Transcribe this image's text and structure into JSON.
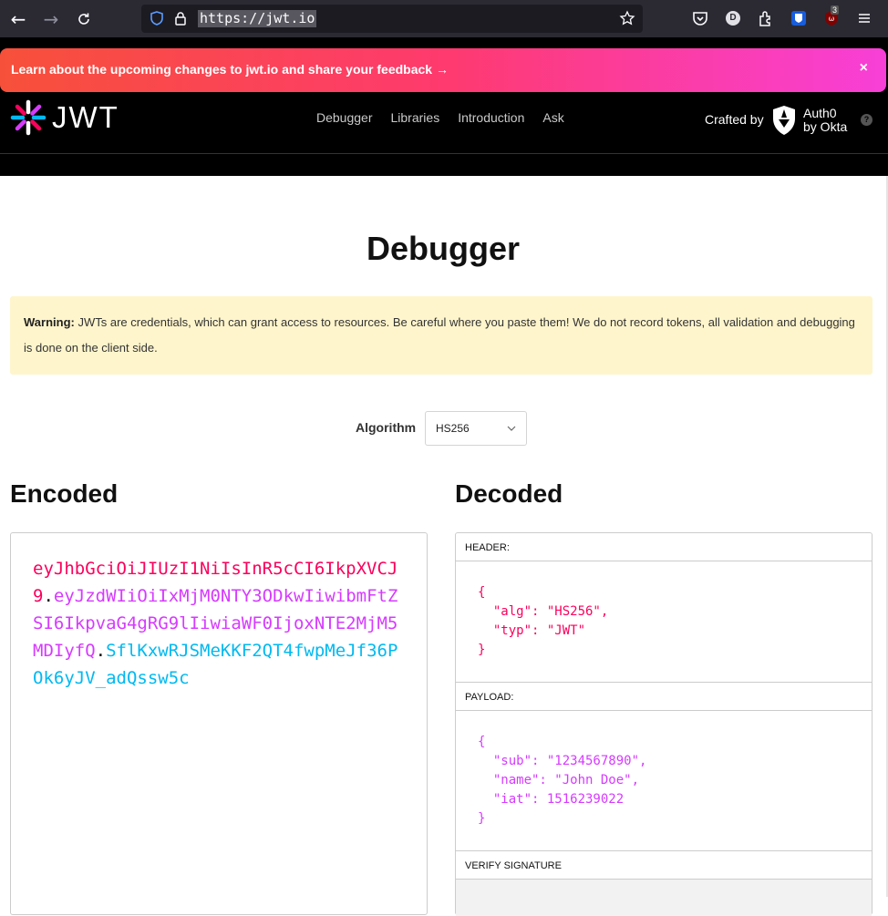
{
  "browser": {
    "url": "https://jwt.io",
    "badge_count": "3",
    "profile_initial": "D"
  },
  "banner": {
    "text": "Learn about the upcoming changes to jwt.io and share your feedback",
    "arrow": "→",
    "close": "×"
  },
  "header": {
    "logo_text": "JWT",
    "nav": [
      "Debugger",
      "Libraries",
      "Introduction",
      "Ask"
    ],
    "crafted_by": "Crafted by",
    "auth0_line1": "Auth0",
    "auth0_line2": "by Okta",
    "help": "?"
  },
  "main": {
    "title": "Debugger",
    "warning_bold": "Warning:",
    "warning_text": " JWTs are credentials, which can grant access to resources. Be careful where you paste them! We do not record tokens, all validation and debugging is done on the client side.",
    "algorithm_label": "Algorithm",
    "algorithm_value": "HS256",
    "encoded_title": "Encoded",
    "decoded_title": "Decoded",
    "token": {
      "header": "eyJhbGciOiJIUzI1NiIsInR5cCI6IkpXVCJ9",
      "payload": "eyJzdWIiOiIxMjM0NTY3ODkwIiwibmFtZSI6IkpvaG4gRG9lIiwiaWF0IjoxNTE2MjM5MDIyfQ",
      "signature": "SflKxwRJSMeKKF2QT4fwpMeJf36POk6yJV_adQssw5c",
      "dot": "."
    },
    "decoded": {
      "header_label": "HEADER:",
      "header_json": "{\n  \"alg\": \"HS256\",\n  \"typ\": \"JWT\"\n}",
      "payload_label": "PAYLOAD:",
      "payload_json": "{\n  \"sub\": \"1234567890\",\n  \"name\": \"John Doe\",\n  \"iat\": 1516239022\n}",
      "verify_label": "VERIFY SIGNATURE"
    }
  }
}
